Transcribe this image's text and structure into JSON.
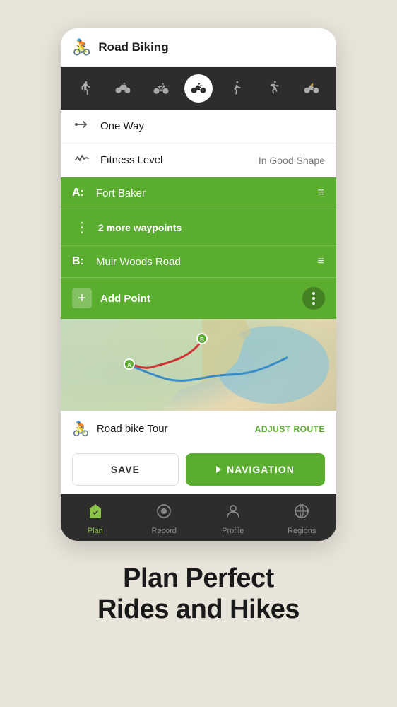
{
  "header": {
    "title": "Road Biking",
    "icon": "🚴"
  },
  "activity_tabs": [
    {
      "id": "hiking",
      "label": "hiking",
      "active": false
    },
    {
      "id": "cycling",
      "label": "cycling",
      "active": false
    },
    {
      "id": "mountain-bike",
      "label": "mountain bike",
      "active": false
    },
    {
      "id": "road-bike",
      "label": "road bike",
      "active": true
    },
    {
      "id": "trail-running",
      "label": "trail running",
      "active": false
    },
    {
      "id": "running",
      "label": "running",
      "active": false
    },
    {
      "id": "ebike",
      "label": "ebike",
      "active": false
    }
  ],
  "options": [
    {
      "icon": "route",
      "label": "One Way",
      "value": ""
    },
    {
      "icon": "fitness",
      "label": "Fitness Level",
      "value": "In Good Shape"
    }
  ],
  "waypoints": {
    "start": {
      "label": "A:",
      "text": "Fort Baker"
    },
    "more": {
      "text": "2 more waypoints"
    },
    "end": {
      "label": "B:",
      "text": "Muir Woods Road"
    },
    "add_point": "Add Point"
  },
  "map": {
    "route_title": "Road bike Tour"
  },
  "bottom_bar": {
    "icon": "🚴",
    "title": "Road bike Tour",
    "adjust_label": "ADJUST ROUTE"
  },
  "buttons": {
    "save": "SAVE",
    "navigation": "NAVIGATION"
  },
  "nav_items": [
    {
      "id": "plan",
      "label": "Plan",
      "active": true
    },
    {
      "id": "record",
      "label": "Record",
      "active": false
    },
    {
      "id": "profile",
      "label": "Profile",
      "active": false
    },
    {
      "id": "regions",
      "label": "Regions",
      "active": false
    }
  ],
  "footer": {
    "line1": "Plan Perfect",
    "line2": "Rides and Hikes"
  },
  "colors": {
    "green": "#5aad2e",
    "dark": "#2d2d2d",
    "active_nav": "#8bc34a"
  }
}
